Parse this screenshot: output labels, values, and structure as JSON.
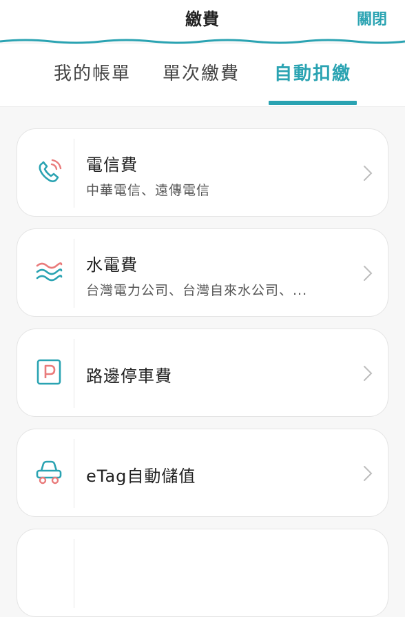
{
  "header": {
    "title": "繳費",
    "close_label": "關閉"
  },
  "tabs": [
    {
      "label": "我的帳單",
      "active": false
    },
    {
      "label": "單次繳費",
      "active": false
    },
    {
      "label": "自動扣繳",
      "active": true
    }
  ],
  "items": [
    {
      "name": "電信費",
      "sub": "中華電信、遠傳電信",
      "icon": "phone-icon"
    },
    {
      "name": "水電費",
      "sub": "台灣電力公司、台灣自來水公司、...",
      "icon": "waves-icon"
    },
    {
      "name": "路邊停車費",
      "sub": "",
      "icon": "parking-icon"
    },
    {
      "name": "eTag自動儲值",
      "sub": "",
      "icon": "car-icon"
    }
  ],
  "colors": {
    "accent": "#2aa3b2",
    "coral": "#e97a7a"
  }
}
